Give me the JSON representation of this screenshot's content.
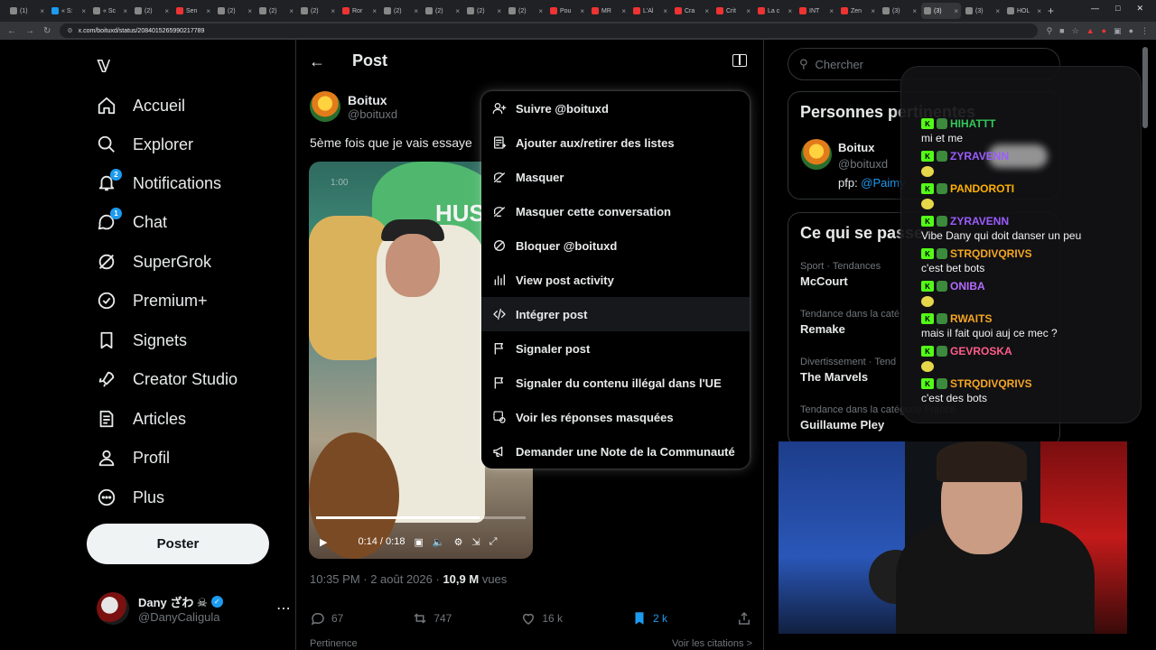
{
  "browser": {
    "url": "x.com/boituxd/status/2084015265990217789",
    "tabs": [
      "(1)",
      "« S:",
      "« Sc",
      "(2)",
      "Sen",
      "(2)",
      "(2)",
      "(2)",
      "Ror",
      "(2)",
      "(2)",
      "(2)",
      "(2)",
      "Pou",
      "MR",
      "L'Al",
      "Cra",
      "Crit",
      "La c",
      "INT",
      "Zen",
      "(3)",
      "(3)",
      "(3)",
      "HOL"
    ],
    "active_tab_index": 22
  },
  "nav": {
    "items": [
      {
        "label": "Accueil",
        "icon": "home-icon"
      },
      {
        "label": "Explorer",
        "icon": "search-icon"
      },
      {
        "label": "Notifications",
        "icon": "bell-icon",
        "badge": "2"
      },
      {
        "label": "Chat",
        "icon": "chat-icon",
        "badge": "1"
      },
      {
        "label": "SuperGrok",
        "icon": "grok-icon"
      },
      {
        "label": "Premium+",
        "icon": "premium-icon"
      },
      {
        "label": "Signets",
        "icon": "bookmark-icon"
      },
      {
        "label": "Creator Studio",
        "icon": "rocket-icon"
      },
      {
        "label": "Articles",
        "icon": "article-icon"
      },
      {
        "label": "Profil",
        "icon": "person-icon"
      },
      {
        "label": "Plus",
        "icon": "more-circle-icon"
      }
    ],
    "post_button": "Poster",
    "account": {
      "name": "Dany ざわ ☠",
      "handle": "@DanyCaligula"
    }
  },
  "post": {
    "header_title": "Post",
    "author_name": "Boitux",
    "author_handle": "@boituxd",
    "text": "5ème fois que je vais essaye",
    "video": {
      "time": "0:14 / 0:18",
      "progress": 0.78,
      "corner_label": "1:00",
      "overlay_text": "HUS"
    },
    "timestamp": "10:35 PM · 2 août 2026 · ",
    "views": "10,9 M",
    "views_suffix": "vues",
    "replies": "67",
    "reposts": "747",
    "likes": "16 k",
    "bookmarks": "2 k",
    "below_left": "Pertinence",
    "below_right": "Voir les citations >"
  },
  "menu": {
    "items": [
      {
        "label": "Suivre @boituxd",
        "icon": "follow-icon"
      },
      {
        "label": "Ajouter aux/retirer des listes",
        "icon": "list-icon"
      },
      {
        "label": "Masquer",
        "icon": "mute-icon"
      },
      {
        "label": "Masquer cette conversation",
        "icon": "mute-conversation-icon"
      },
      {
        "label": "Bloquer @boituxd",
        "icon": "block-icon"
      },
      {
        "label": "View post activity",
        "icon": "bar-chart-icon"
      },
      {
        "label": "Intégrer post",
        "icon": "embed-icon"
      },
      {
        "label": "Signaler post",
        "icon": "flag-icon"
      },
      {
        "label": "Signaler du contenu illégal dans l'UE",
        "icon": "flag-icon"
      },
      {
        "label": "Voir les réponses masquées",
        "icon": "hidden-replies-icon"
      },
      {
        "label": "Demander une Note de la Communauté",
        "icon": "megaphone-icon"
      }
    ],
    "hovered_index": 6
  },
  "right": {
    "search_placeholder": "Chercher",
    "panel1_title": "Personnes pertinentes",
    "person_name": "Boitux",
    "person_handle": "@boituxd",
    "person_bio": "pfp: ",
    "person_bio_link": "@Paimy",
    "panel2_title": "Ce qui se passe",
    "trends": [
      {
        "context": "Sport · Tendances",
        "title": "McCourt"
      },
      {
        "context": "Tendance dans la caté",
        "title": "Remake"
      },
      {
        "context": "Divertissement · Tend",
        "title": "The Marvels"
      },
      {
        "context": "Tendance dans la catégorie France",
        "title": "Guillaume Pley"
      }
    ]
  },
  "chat": {
    "messages": [
      {
        "user": "HIHATTT",
        "color": "#34c759",
        "text": "mi et me"
      },
      {
        "user": "ZYRAVENN",
        "color": "#9c5cff",
        "text": ""
      },
      {
        "user": "PANDOROTI",
        "color": "#ffb000",
        "text": ""
      },
      {
        "user": "ZYRAVENN",
        "color": "#9c5cff",
        "text": "Vibe Dany qui doit danser un peu"
      },
      {
        "user": "STRQDIVQRIVS",
        "color": "#f5a524",
        "text": "c'est bet bots"
      },
      {
        "user": "ONIBA",
        "color": "#b36bff",
        "text": ""
      },
      {
        "user": "RWAITS",
        "color": "#f5a524",
        "text": "mais il fait quoi auj ce mec ?"
      },
      {
        "user": "GEVROSKA",
        "color": "#ff5c8a",
        "text": ""
      },
      {
        "user": "STRQDIVQRIVS",
        "color": "#f5a524",
        "text": "c'est des bots"
      }
    ]
  },
  "colors": {
    "accent": "#1d9bf0",
    "kick": "#53fc18"
  }
}
